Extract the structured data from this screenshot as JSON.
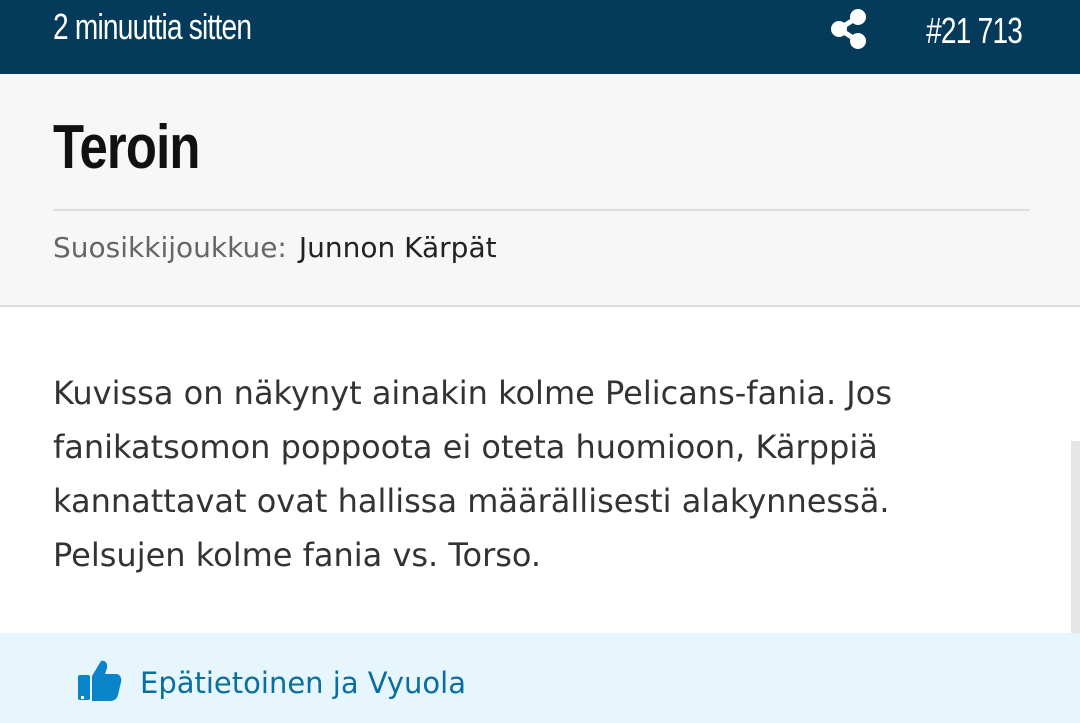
{
  "header": {
    "timestamp": "2 minuuttia sitten",
    "post_number": "#21 713",
    "share_icon": "share-icon",
    "background_color": "#043a5a"
  },
  "author": {
    "name": "Teroin",
    "favorite_team_label": "Suosikkijoukkue:",
    "favorite_team": "Junnon Kärpät"
  },
  "post": {
    "text": "Kuvissa on näkynyt ainakin kolme Pelicans-fania. Jos fanikatsomon poppoota ei oteta huomioon, Kärppiä kannattavat ovat hallissa määrällisesti alakynnessä. Pelsujen kolme fania vs. Torso."
  },
  "likes": {
    "icon": "thumbs-up-icon",
    "text": "Epätietoinen ja Vyuola",
    "accent_color": "#0a6e9f"
  }
}
